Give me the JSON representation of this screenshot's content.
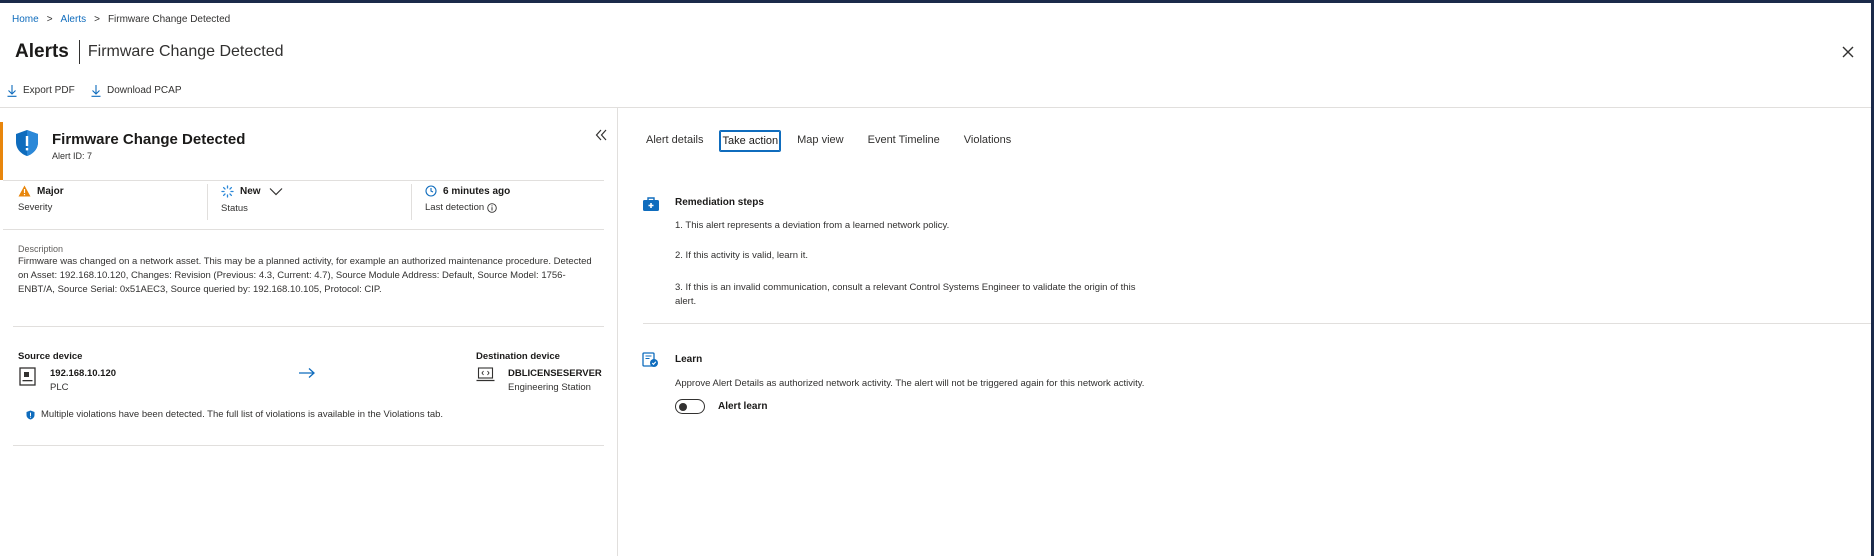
{
  "breadcrumb": {
    "home": "Home",
    "alerts": "Alerts",
    "current": "Firmware Change Detected",
    "separator": ">"
  },
  "header": {
    "title": "Alerts",
    "subtitle": "Firmware Change Detected"
  },
  "commands": {
    "export_pdf": "Export PDF",
    "download_pcap": "Download PCAP"
  },
  "alert": {
    "title": "Firmware Change Detected",
    "id": "Alert ID: 7",
    "severity": {
      "value": "Major",
      "label": "Severity"
    },
    "status": {
      "value": "New",
      "label": "Status"
    },
    "last_detection": {
      "value": "6 minutes ago",
      "label": "Last detection"
    },
    "description_label": "Description",
    "description": "Firmware was changed on a network asset. This may be a planned activity, for example an authorized maintenance procedure. Detected on Asset: 192.168.10.120, Changes: Revision (Previous: 4.3, Current: 4.7), Source Module Address: Default, Source Model: 1756-ENBT/A, Source Serial: 0x51AEC3, Source queried by: 192.168.10.105, Protocol: CIP."
  },
  "source_device": {
    "label": "Source device",
    "name": "192.168.10.120",
    "type": "PLC"
  },
  "destination_device": {
    "label": "Destination device",
    "name": "DBLICENSESERVER",
    "type": "Engineering Station"
  },
  "violations_notice": "Multiple violations have been detected. The full list of violations is available in the Violations tab.",
  "tabs": [
    "Alert details",
    "Take action",
    "Map view",
    "Event Timeline",
    "Violations"
  ],
  "active_tab": "Take action",
  "remediation": {
    "title": "Remediation steps",
    "steps": [
      "1. This alert represents a deviation from a learned network policy.",
      "2. If this activity is valid, learn it.",
      "3. If this is an invalid communication, consult a relevant Control Systems Engineer to validate the origin of this alert."
    ]
  },
  "learn": {
    "title": "Learn",
    "text": "Approve Alert Details as authorized network activity. The alert will not be triggered again for this network activity.",
    "toggle_label": "Alert learn",
    "toggle_on": false
  },
  "colors": {
    "accent": "#0f6cbd",
    "severity_major": "#e8860c",
    "status_new": "#2b88d8"
  }
}
